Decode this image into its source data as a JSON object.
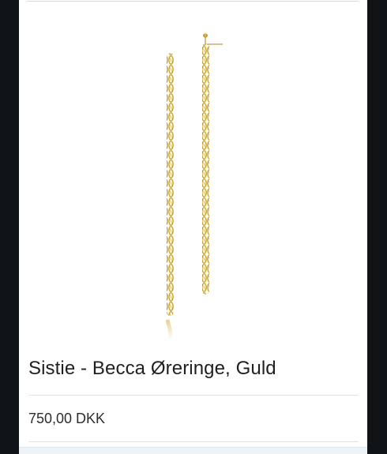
{
  "product": {
    "title": "Sistie - Becca Øreringe, Guld",
    "price": "750,00 DKK",
    "image_icon": "gold-curb-chain-earrings-image"
  },
  "colors": {
    "page_background": "#ffffff",
    "screen_frame": "#101416",
    "text_primary": "#1f1f1f",
    "text_secondary": "#2d2d2d",
    "divider": "#e2e2e2",
    "gold": "#c8a32d"
  }
}
